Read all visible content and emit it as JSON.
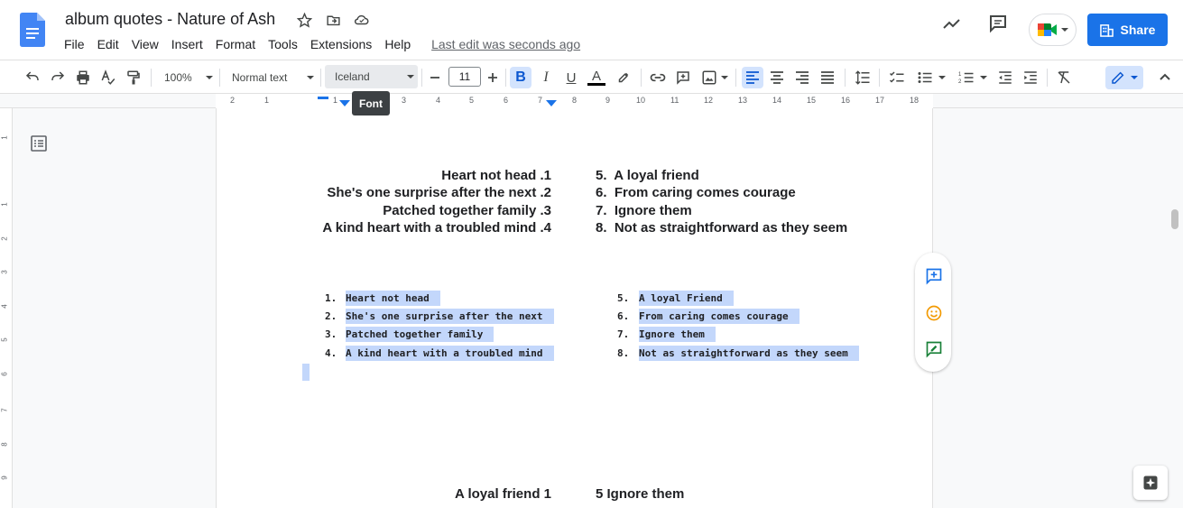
{
  "app": {
    "doc_title": "album quotes - Nature of Ash",
    "last_edit": "Last edit was seconds ago",
    "share_label": "Share"
  },
  "menu": [
    "File",
    "Edit",
    "View",
    "Insert",
    "Format",
    "Tools",
    "Extensions",
    "Help"
  ],
  "toolbar": {
    "zoom": "100%",
    "style": "Normal text",
    "font": "Iceland",
    "font_size": "11",
    "tooltip": "Font"
  },
  "ruler": {
    "marks": [
      "2",
      "1",
      "1",
      "2",
      "3",
      "4",
      "5",
      "6",
      "7",
      "8",
      "9",
      "10",
      "11",
      "12",
      "13",
      "14",
      "15",
      "16",
      "17",
      "18"
    ],
    "left_marks": [
      "1",
      "1",
      "2",
      "3",
      "4",
      "5",
      "6",
      "7",
      "8",
      "9"
    ]
  },
  "document": {
    "rtl_list_left": [
      "Heart not head  .1",
      "She's one surprise after the next  .2",
      "Patched together family  .3",
      "A kind heart with a troubled mind  .4"
    ],
    "rtl_list_right": [
      "5.  A loyal friend",
      "6.  From caring comes courage",
      "7.  Ignore them",
      "8.  Not as straightforward as they seem"
    ],
    "selected_left": [
      {
        "num": "1.",
        "text": "Heart not head"
      },
      {
        "num": "2.",
        "text": "She's one surprise after the next"
      },
      {
        "num": "3.",
        "text": "Patched together family"
      },
      {
        "num": "4.",
        "text": "A kind heart with a troubled mind"
      }
    ],
    "selected_right": [
      {
        "num": "5.",
        "text": "A loyal Friend"
      },
      {
        "num": "6.",
        "text": "From caring comes courage"
      },
      {
        "num": "7.",
        "text": "Ignore them"
      },
      {
        "num": "8.",
        "text": "Not as straightforward as they seem"
      }
    ],
    "bottom_left": "A loyal friend 1",
    "bottom_right": "5 Ignore them"
  },
  "colors": {
    "accent": "#1a73e8",
    "selection": "#c3d7fb"
  }
}
